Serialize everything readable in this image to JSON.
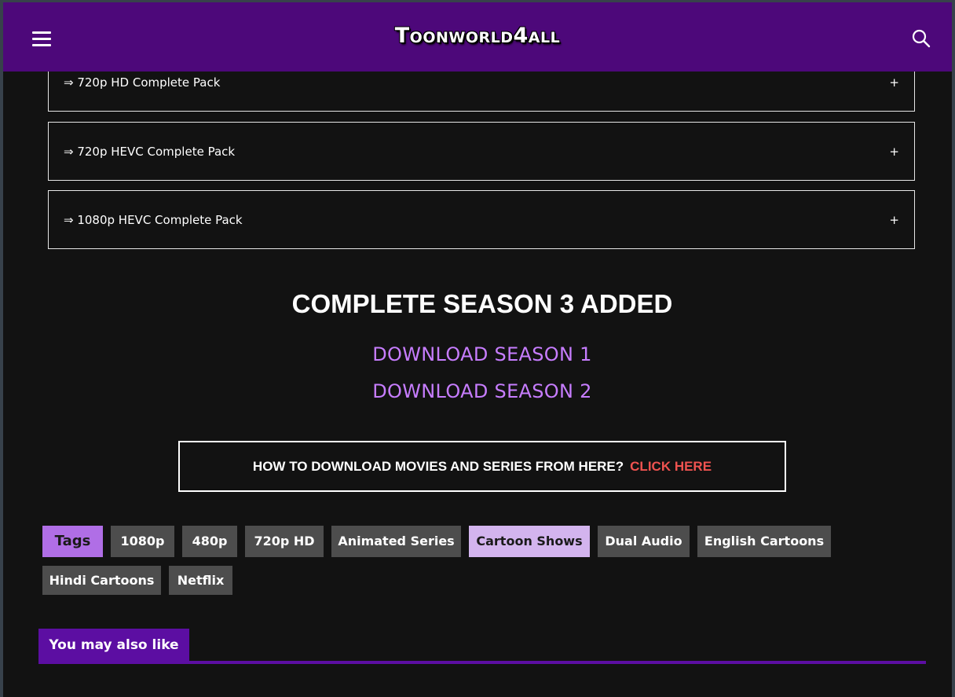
{
  "header": {
    "logo_text": "Toonworld4all",
    "menu_icon": "hamburger-menu-icon",
    "search_icon": "search-icon"
  },
  "accordions": [
    {
      "label": "⇒ 720p HD Complete Pack",
      "toggle": "+"
    },
    {
      "label": "⇒ 720p HEVC Complete Pack",
      "toggle": "+"
    },
    {
      "label": "⇒ 1080p HEVC Complete Pack",
      "toggle": "+"
    }
  ],
  "content": {
    "season_title": "COMPLETE SEASON 3 ADDED",
    "download_links": [
      "DOWNLOAD SEASON 1",
      "DOWNLOAD SEASON 2"
    ],
    "howto_question": "HOW TO DOWNLOAD MOVIES AND SERIES FROM HERE?",
    "howto_cta": "CLICK HERE"
  },
  "tags": {
    "label": "Tags",
    "items": [
      "1080p",
      "480p",
      "720p HD",
      "Animated Series",
      "Cartoon Shows",
      "Dual Audio",
      "English Cartoons",
      "Hindi Cartoons",
      "Netflix"
    ],
    "active": "Cartoon Shows"
  },
  "related": {
    "heading": "You may also like"
  },
  "colors": {
    "header_bg": "#4d087a",
    "page_bg": "#121212",
    "link_purple": "#c77dff",
    "cta_red": "#ef5350",
    "tag_bg": "#4d4d4d",
    "tag_label_bg": "#b06ee6",
    "tag_active_bg": "#d3b4ee",
    "section_purple": "#5c0ea2"
  }
}
